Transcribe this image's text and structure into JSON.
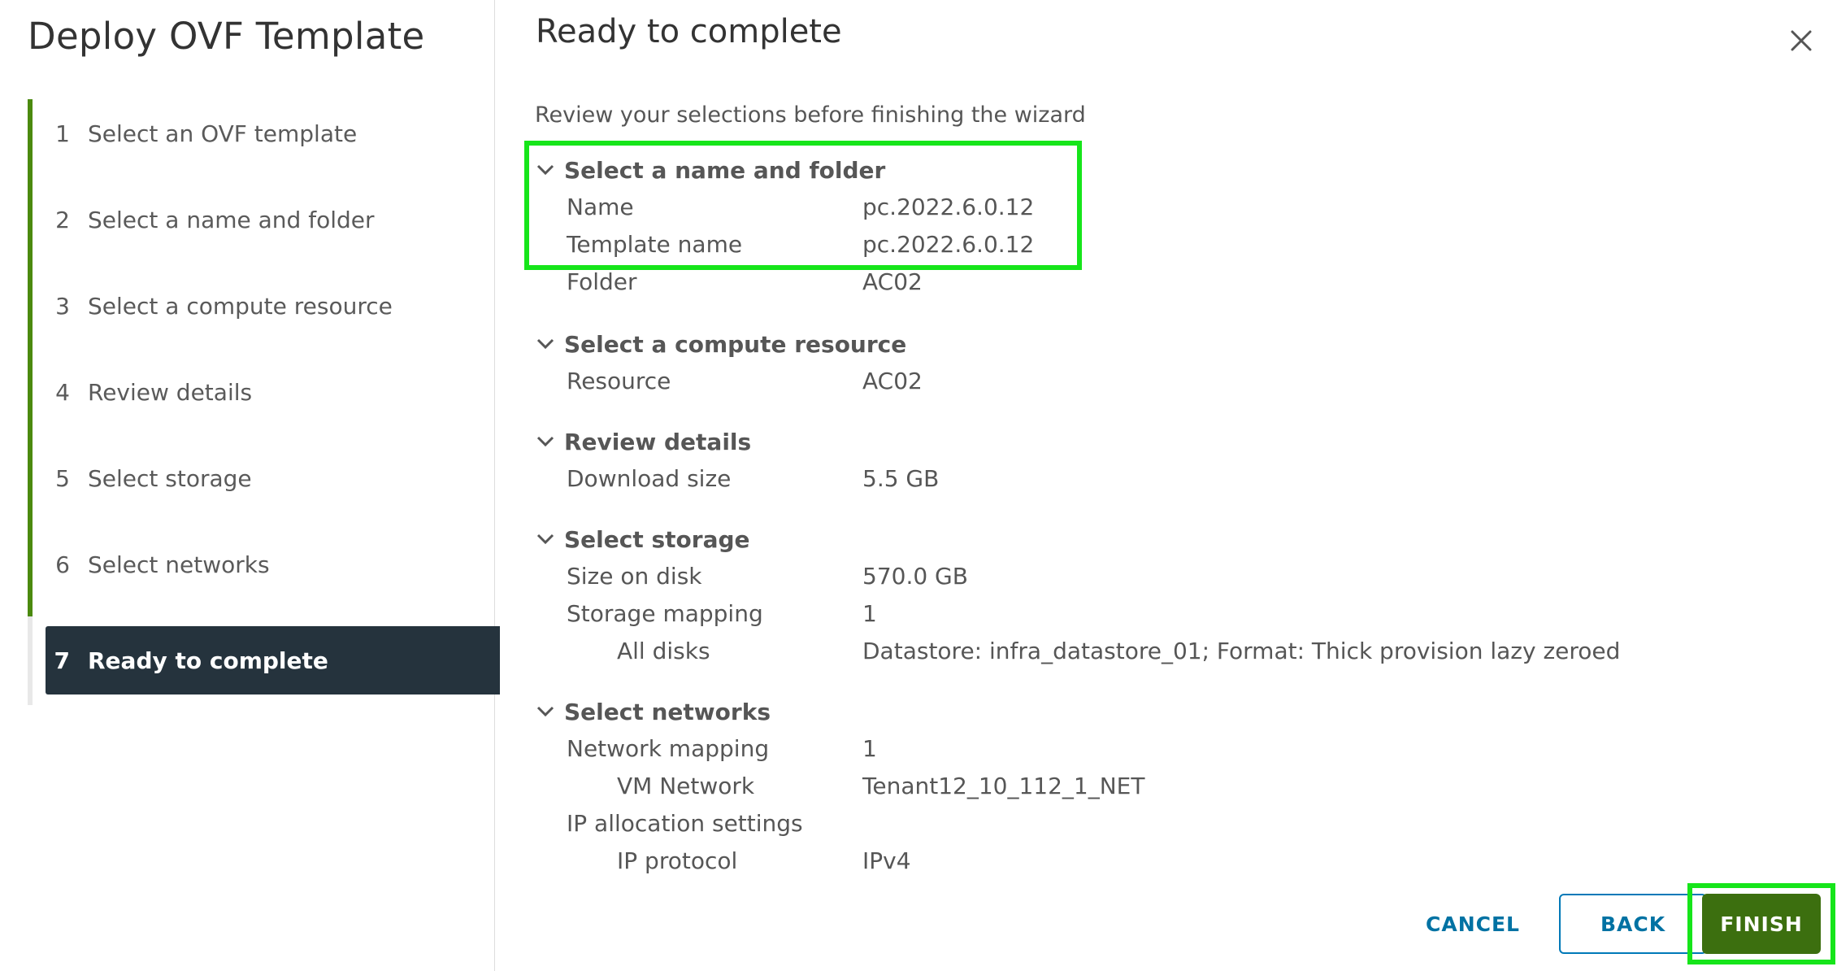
{
  "wizard": {
    "title": "Deploy OVF Template"
  },
  "steps": [
    {
      "num": "1",
      "label": "Select an OVF template"
    },
    {
      "num": "2",
      "label": "Select a name and folder"
    },
    {
      "num": "3",
      "label": "Select a compute resource"
    },
    {
      "num": "4",
      "label": "Review details"
    },
    {
      "num": "5",
      "label": "Select storage"
    },
    {
      "num": "6",
      "label": "Select networks"
    },
    {
      "num": "7",
      "label": "Ready to complete"
    }
  ],
  "main": {
    "title": "Ready to complete",
    "intro": "Review your selections before finishing the wizard",
    "close_icon": "close-icon"
  },
  "sections": {
    "name_folder": {
      "title": "Select a name and folder",
      "rows": [
        {
          "k": "Name",
          "v": "pc.2022.6.0.12"
        },
        {
          "k": "Template name",
          "v": "pc.2022.6.0.12"
        },
        {
          "k": "Folder",
          "v": "AC02"
        }
      ]
    },
    "compute": {
      "title": "Select a compute resource",
      "rows": [
        {
          "k": "Resource",
          "v": "AC02"
        }
      ]
    },
    "review": {
      "title": "Review details",
      "rows": [
        {
          "k": "Download size",
          "v": "5.5 GB"
        }
      ]
    },
    "storage": {
      "title": "Select storage",
      "rows": [
        {
          "k": "Size on disk",
          "v": "570.0 GB"
        },
        {
          "k": "Storage mapping",
          "v": "1"
        },
        {
          "k": "All disks",
          "v": "Datastore: infra_datastore_01; Format: Thick provision lazy zeroed"
        }
      ]
    },
    "networks": {
      "title": "Select networks",
      "rows": [
        {
          "k": "Network mapping",
          "v": "1"
        },
        {
          "k": "VM Network",
          "v": "Tenant12_10_112_1_NET"
        },
        {
          "k": "IP allocation settings",
          "v": ""
        },
        {
          "k": "IP protocol",
          "v": "IPv4"
        }
      ]
    }
  },
  "footer": {
    "cancel": "CANCEL",
    "back": "BACK",
    "finish": "FINISH"
  },
  "colors": {
    "accent_green": "#3c6f0f",
    "nav_active_bg": "#25333d",
    "link_blue": "#0072a3",
    "highlight": "#16e51a"
  }
}
